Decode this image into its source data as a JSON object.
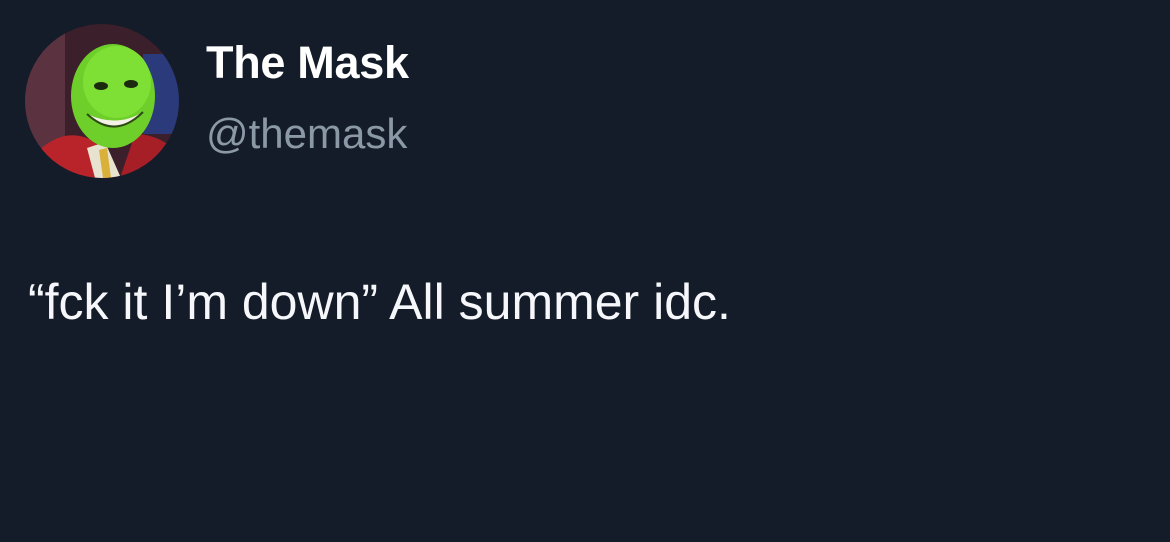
{
  "author": {
    "display_name": "The Mask",
    "handle": "@themask",
    "avatar_icon": "green-mask-face-avatar"
  },
  "tweet": {
    "text": "“fck it I’m down” All summer idc."
  },
  "colors": {
    "background": "#151c29",
    "name": "#ffffff",
    "handle": "#8b98a5",
    "text": "#f5f7fa"
  }
}
